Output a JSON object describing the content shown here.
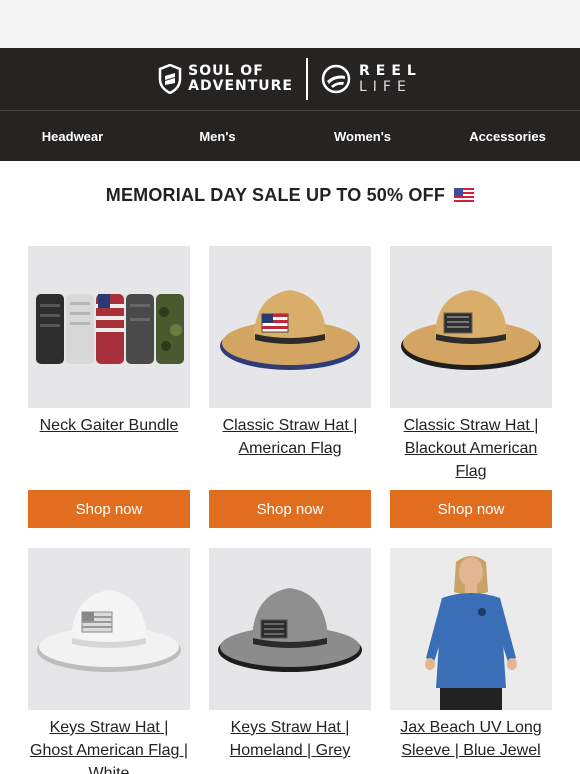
{
  "brand": {
    "soa_line1": "SOUL OF",
    "soa_line2": "ADVENTURE",
    "reel_line1": "REEL",
    "reel_line2": "LIFE",
    "shield_text": "S"
  },
  "nav": [
    "Headwear",
    "Men's",
    "Women's",
    "Accessories"
  ],
  "promo": {
    "text": "MEMORIAL DAY SALE UP TO 50% OFF",
    "emoji": "us-flag-emoji"
  },
  "products": [
    {
      "name": "Neck Gaiter Bundle",
      "cta": "Shop now"
    },
    {
      "name": "Classic Straw Hat | American Flag",
      "cta": "Shop now"
    },
    {
      "name": "Classic Straw Hat | Blackout American Flag",
      "cta": "Shop now"
    },
    {
      "name": "Keys Straw Hat | Ghost American Flag | White"
    },
    {
      "name": "Keys Straw Hat | Homeland | Grey"
    },
    {
      "name": "Jax Beach UV Long Sleeve | Blue Jewel"
    }
  ],
  "colors": {
    "header_bg": "#262323",
    "button": "#e06e1e",
    "page_bg": "#f4f4f4"
  }
}
